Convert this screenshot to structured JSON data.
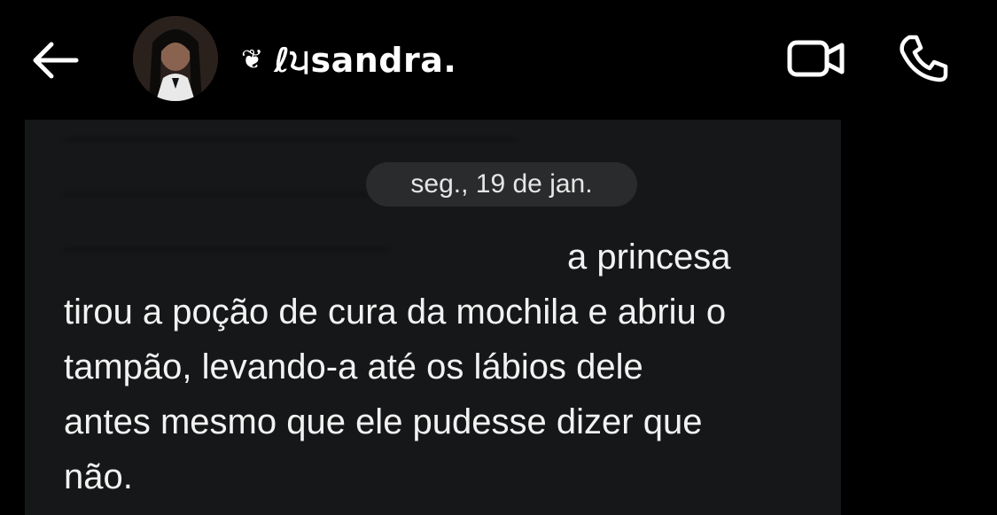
{
  "header": {
    "contact_name": "ℓ੫sandra.",
    "name_emoji": "❦"
  },
  "chat": {
    "date_separator": "seg., 19 de jan.",
    "message": {
      "lines": [
        "a princesa",
        "tirou a poção de cura da mochila e abriu o",
        "tampão, levando-a até os lábios dele",
        "antes mesmo que ele pudesse dizer que",
        "não."
      ]
    }
  },
  "icons": {
    "back": "arrow-left-icon",
    "video": "video-camera-icon",
    "phone": "phone-icon"
  },
  "colors": {
    "background": "#000000",
    "bubble": "#161718",
    "date_chip": "#2a2b2d",
    "text": "#f2f2f2"
  }
}
